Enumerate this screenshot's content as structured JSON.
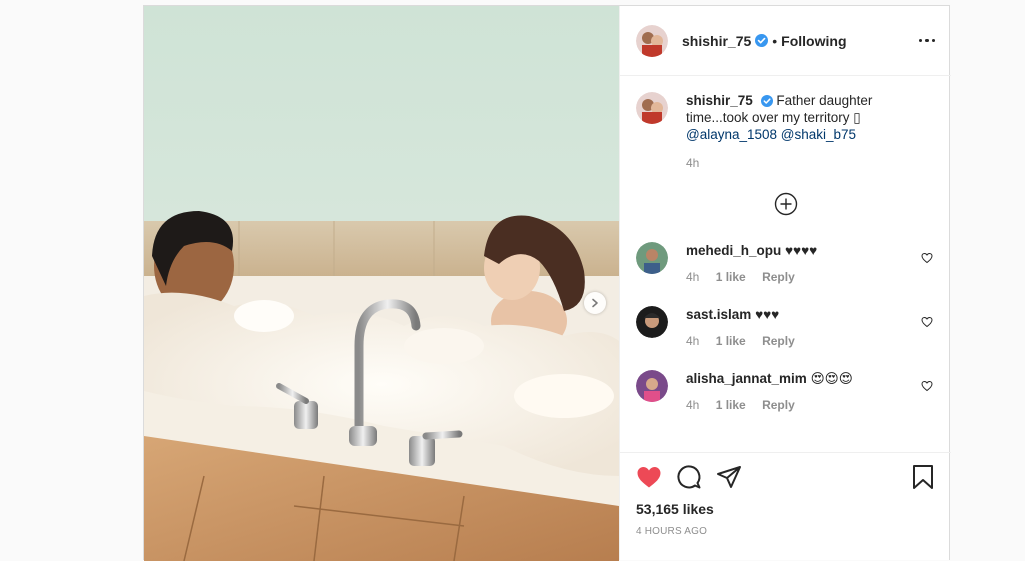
{
  "post": {
    "author": "shishir_75",
    "follow_sep": "•",
    "follow_status": "Following",
    "caption": {
      "username": "shishir_75",
      "text": "Father daughter time...took over my territory ▯",
      "mention1": "@alayna_1508",
      "mention2": "@shaki_b75",
      "time": "4h"
    },
    "comments": [
      {
        "username": "mehedi_h_opu",
        "text": "♥♥♥♥",
        "time": "4h",
        "likes": "1 like",
        "reply": "Reply"
      },
      {
        "username": "sast.islam",
        "text": "♥♥♥",
        "time": "4h",
        "likes": "1 like",
        "reply": "Reply"
      },
      {
        "username": "alisha_jannat_mim",
        "text": "😍😍😍",
        "time": "4h",
        "likes": "1 like",
        "reply": "Reply"
      }
    ],
    "likes": "53,165 likes",
    "timestamp": "4 HOURS AGO"
  },
  "icons": {
    "verified": "verified-badge-icon",
    "more": "more-options-icon",
    "load_more": "plus-circle-icon",
    "like": "heart-filled-icon",
    "comment": "comment-bubble-icon",
    "share": "paper-plane-icon",
    "save": "bookmark-icon",
    "next": "chevron-right-icon"
  },
  "colors": {
    "like_red": "#ed4956",
    "verified_blue": "#3897f0",
    "mention": "#00376b",
    "muted": "#8e8e8e"
  }
}
